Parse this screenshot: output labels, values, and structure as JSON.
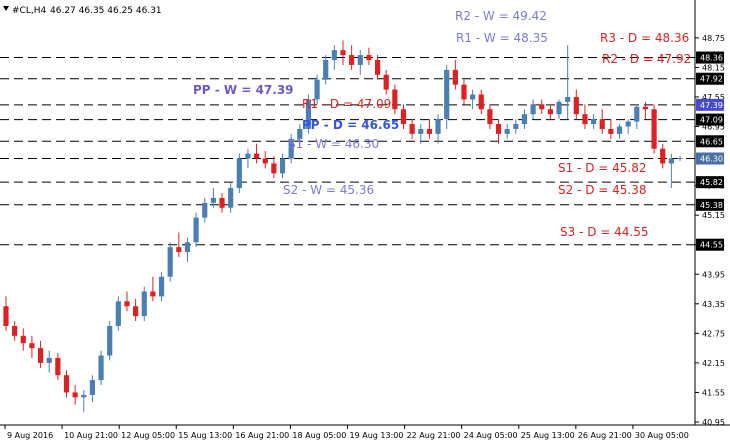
{
  "header": {
    "symbol": "#CL,H4",
    "ohlc": "46.27 46.35 46.25 46.31"
  },
  "chart_data": {
    "type": "candlestick",
    "symbol": "#CL",
    "timeframe": "H4",
    "ylim": [
      40.95,
      48.95
    ],
    "y_ticks": [
      {
        "value": 48.75,
        "label": "48.75"
      },
      {
        "value": 48.15,
        "label": "48.15"
      },
      {
        "value": 47.55,
        "label": "47.55"
      },
      {
        "value": 46.95,
        "label": "46.95"
      },
      {
        "value": 45.75,
        "label": "45.75"
      },
      {
        "value": 45.15,
        "label": "45.15"
      },
      {
        "value": 44.55,
        "label": "44.55"
      },
      {
        "value": 43.95,
        "label": "43.95"
      },
      {
        "value": 43.35,
        "label": "43.35"
      },
      {
        "value": 42.75,
        "label": "42.75"
      },
      {
        "value": 42.15,
        "label": "42.15"
      },
      {
        "value": 41.55,
        "label": "41.55"
      },
      {
        "value": 40.95,
        "label": "40.95"
      }
    ],
    "x_labels": [
      "9 Aug 2016",
      "10 Aug 21:00",
      "12 Aug 05:00",
      "15 Aug 13:00",
      "16 Aug 21:00",
      "18 Aug 05:00",
      "19 Aug 13:00",
      "22 Aug 21:00",
      "24 Aug 05:00",
      "25 Aug 13:00",
      "26 Aug 21:00",
      "30 Aug 05:00"
    ],
    "pivot_levels": [
      {
        "label": "R2 - W = 49.42",
        "value": 49.42,
        "color": "#7b7bd6",
        "bold": false,
        "line": false
      },
      {
        "label": "R1 - W = 48.35",
        "value": 48.35,
        "color": "#7b7bd6",
        "bold": false,
        "line": true,
        "price_label": "48.36",
        "box": "#000000"
      },
      {
        "label": "R3 - D = 48.36",
        "value": 48.36,
        "color": "#e02020",
        "bold": false,
        "line": false
      },
      {
        "label": "R2 - D = 47.92",
        "value": 47.92,
        "color": "#e02020",
        "bold": false,
        "line": true,
        "price_label": "47.92",
        "box": "#000000"
      },
      {
        "label": "PP - W = 47.39",
        "value": 47.39,
        "color": "#6a5acd",
        "bold": true,
        "line": true,
        "price_label": "47.39",
        "box": "#4a4ad0"
      },
      {
        "label": "R1 - D = 47.09",
        "value": 47.09,
        "color": "#e02020",
        "bold": false,
        "line": true,
        "price_label": "47.09",
        "box": "#000000"
      },
      {
        "label": "PP - D = 46.65",
        "value": 46.65,
        "color": "#3355dd",
        "bold": true,
        "line": true,
        "price_label": "46.65",
        "box": "#000000"
      },
      {
        "label": "S1 - W = 46.30",
        "value": 46.3,
        "color": "#7b7bd6",
        "bold": false,
        "line": true,
        "price_label": "46.30",
        "box": "#4a6fa5"
      },
      {
        "label": "S1 - D = 45.82",
        "value": 45.82,
        "color": "#e02020",
        "bold": false,
        "line": true,
        "price_label": "45.82",
        "box": "#000000"
      },
      {
        "label": "S2 - W = 45.36",
        "value": 45.36,
        "color": "#7b7bd6",
        "bold": false,
        "line": true,
        "price_label": "45.38",
        "box": "#000000"
      },
      {
        "label": "S2 - D = 45.38",
        "value": 45.38,
        "color": "#e02020",
        "bold": false,
        "line": false
      },
      {
        "label": "S3 - D = 44.55",
        "value": 44.55,
        "color": "#e02020",
        "bold": false,
        "line": true,
        "price_label": "44.55",
        "box": "#000000"
      }
    ],
    "bull_color": "#4a7fb5",
    "bear_color": "#e02020",
    "candles": [
      [
        43.3,
        43.5,
        42.8,
        42.9
      ],
      [
        42.9,
        43.0,
        42.6,
        42.7
      ],
      [
        42.7,
        42.85,
        42.4,
        42.55
      ],
      [
        42.55,
        42.7,
        42.25,
        42.45
      ],
      [
        42.45,
        42.6,
        42.05,
        42.15
      ],
      [
        42.15,
        42.4,
        41.95,
        42.25
      ],
      [
        42.25,
        42.35,
        41.8,
        41.9
      ],
      [
        41.9,
        42.0,
        41.45,
        41.55
      ],
      [
        41.55,
        41.7,
        41.3,
        41.45
      ],
      [
        41.45,
        41.6,
        41.15,
        41.5
      ],
      [
        41.5,
        41.9,
        41.35,
        41.8
      ],
      [
        41.8,
        42.4,
        41.7,
        42.3
      ],
      [
        42.3,
        43.0,
        42.2,
        42.9
      ],
      [
        42.9,
        43.5,
        42.8,
        43.4
      ],
      [
        43.4,
        43.6,
        43.2,
        43.3
      ],
      [
        43.3,
        43.45,
        43.0,
        43.1
      ],
      [
        43.1,
        43.7,
        43.0,
        43.6
      ],
      [
        43.6,
        43.9,
        43.4,
        43.5
      ],
      [
        43.5,
        44.0,
        43.4,
        43.9
      ],
      [
        43.9,
        44.6,
        43.8,
        44.5
      ],
      [
        44.5,
        44.8,
        44.3,
        44.4
      ],
      [
        44.4,
        44.7,
        44.2,
        44.6
      ],
      [
        44.6,
        45.2,
        44.5,
        45.1
      ],
      [
        45.1,
        45.5,
        45.0,
        45.4
      ],
      [
        45.4,
        45.7,
        45.3,
        45.5
      ],
      [
        45.5,
        45.6,
        45.2,
        45.3
      ],
      [
        45.3,
        45.8,
        45.2,
        45.7
      ],
      [
        45.7,
        46.4,
        45.6,
        46.3
      ],
      [
        46.3,
        46.5,
        46.1,
        46.4
      ],
      [
        46.4,
        46.6,
        46.2,
        46.3
      ],
      [
        46.3,
        46.45,
        46.1,
        46.2
      ],
      [
        46.2,
        46.35,
        45.9,
        46.0
      ],
      [
        46.0,
        46.4,
        45.9,
        46.3
      ],
      [
        46.3,
        46.8,
        46.2,
        46.7
      ],
      [
        46.7,
        47.0,
        46.6,
        46.9
      ],
      [
        46.9,
        47.6,
        46.8,
        47.5
      ],
      [
        47.5,
        48.0,
        47.4,
        47.9
      ],
      [
        47.9,
        48.4,
        47.8,
        48.3
      ],
      [
        48.3,
        48.6,
        48.1,
        48.5
      ],
      [
        48.5,
        48.7,
        48.2,
        48.4
      ],
      [
        48.4,
        48.6,
        48.1,
        48.2
      ],
      [
        48.2,
        48.5,
        48.0,
        48.4
      ],
      [
        48.4,
        48.55,
        48.2,
        48.3
      ],
      [
        48.3,
        48.4,
        47.9,
        48.0
      ],
      [
        48.0,
        48.1,
        47.6,
        47.7
      ],
      [
        47.7,
        47.8,
        47.2,
        47.3
      ],
      [
        47.3,
        47.4,
        46.9,
        47.0
      ],
      [
        47.0,
        47.1,
        46.7,
        46.8
      ],
      [
        46.8,
        47.0,
        46.6,
        46.9
      ],
      [
        46.9,
        47.1,
        46.7,
        46.8
      ],
      [
        46.8,
        47.2,
        46.6,
        47.1
      ],
      [
        47.1,
        48.2,
        46.9,
        48.1
      ],
      [
        48.1,
        48.3,
        47.7,
        47.8
      ],
      [
        47.8,
        47.9,
        47.4,
        47.5
      ],
      [
        47.5,
        47.7,
        47.3,
        47.6
      ],
      [
        47.6,
        47.7,
        47.2,
        47.3
      ],
      [
        47.3,
        47.4,
        46.9,
        47.0
      ],
      [
        47.0,
        47.1,
        46.6,
        46.8
      ],
      [
        46.8,
        47.0,
        46.7,
        46.9
      ],
      [
        46.9,
        47.1,
        46.8,
        47.0
      ],
      [
        47.0,
        47.3,
        46.9,
        47.2
      ],
      [
        47.2,
        47.5,
        47.1,
        47.4
      ],
      [
        47.4,
        47.5,
        47.2,
        47.3
      ],
      [
        47.3,
        47.4,
        47.1,
        47.2
      ],
      [
        47.2,
        47.5,
        47.1,
        47.45
      ],
      [
        47.45,
        48.6,
        47.1,
        47.55
      ],
      [
        47.55,
        47.7,
        47.1,
        47.2
      ],
      [
        47.2,
        47.4,
        46.9,
        47.0
      ],
      [
        47.0,
        47.2,
        46.9,
        47.1
      ],
      [
        47.1,
        47.3,
        46.8,
        46.9
      ],
      [
        46.9,
        47.1,
        46.7,
        46.8
      ],
      [
        46.8,
        47.0,
        46.7,
        46.95
      ],
      [
        46.95,
        47.1,
        46.8,
        47.05
      ],
      [
        47.05,
        47.4,
        46.9,
        47.35
      ],
      [
        47.35,
        47.45,
        47.1,
        47.3
      ],
      [
        47.3,
        47.4,
        46.4,
        46.5
      ],
      [
        46.5,
        46.6,
        46.1,
        46.2
      ],
      [
        46.2,
        46.4,
        45.7,
        46.3
      ],
      [
        46.3,
        46.35,
        46.25,
        46.31
      ]
    ]
  }
}
